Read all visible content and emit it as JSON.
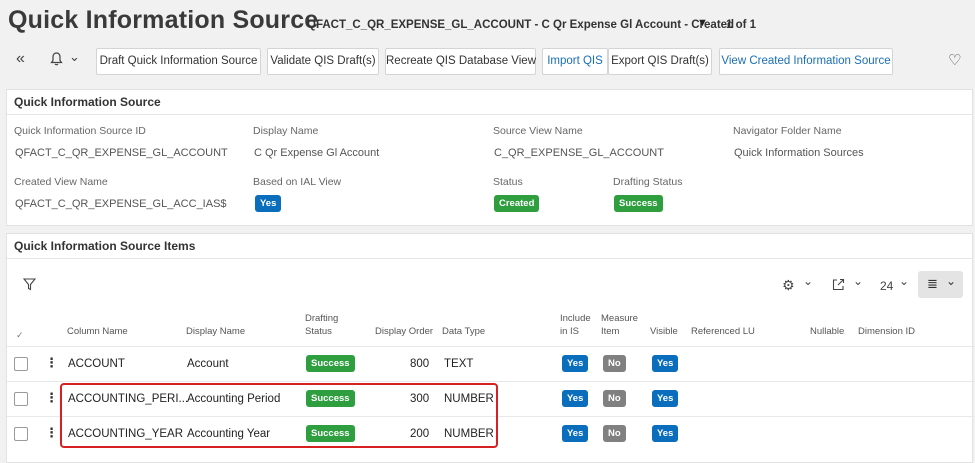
{
  "header": {
    "title": "Quick Information Source",
    "record": "QFACT_C_QR_EXPENSE_GL_ACCOUNT - C Qr Expense Gl Account - Created",
    "dropdown_glyph": "▼",
    "counter": "1 of 1"
  },
  "toolbar": {
    "collapse_icon": "«",
    "bell_icon": "🔔",
    "bell_chevron": "⌄",
    "buttons": [
      "Draft Quick Information Source",
      "Validate QIS Draft(s)",
      "Recreate QIS Database View",
      "Import QIS",
      "Export QIS Draft(s)",
      "View Created Information Source"
    ],
    "favorite_icon": "♡"
  },
  "details": {
    "heading": "Quick Information Source",
    "fields": {
      "qis_id": {
        "label": "Quick Information Source ID",
        "value": "QFACT_C_QR_EXPENSE_GL_ACCOUNT"
      },
      "display_name": {
        "label": "Display Name",
        "value": "C Qr Expense Gl Account"
      },
      "source_view": {
        "label": "Source View Name",
        "value": "C_QR_EXPENSE_GL_ACCOUNT"
      },
      "navigator_folder": {
        "label": "Navigator Folder Name",
        "value": "Quick Information Sources"
      },
      "created_view": {
        "label": "Created View Name",
        "value": "QFACT_C_QR_EXPENSE_GL_ACC_IAS$"
      },
      "based_on_ial": {
        "label": "Based on IAL View",
        "value": "Yes"
      },
      "status": {
        "label": "Status",
        "value": "Created"
      },
      "drafting_status": {
        "label": "Drafting Status",
        "value": "Success"
      }
    }
  },
  "items": {
    "heading": "Quick Information Source Items",
    "filter_icon": "⛉",
    "settings_icon": "⚙",
    "export_icon": "⇪",
    "chevron": "⌄",
    "page_size": "24",
    "view_icon": "≣",
    "select_all_glyph": "✓",
    "columns": {
      "column_name": "Column Name",
      "display_name": "Display Name",
      "drafting_status_1": "Drafting",
      "drafting_status_2": "Status",
      "display_order": "Display Order",
      "data_type": "Data Type",
      "include_1": "Include",
      "include_2": "in IS",
      "measure_1": "Measure",
      "measure_2": "Item",
      "visible": "Visible",
      "referenced_lu": "Referenced LU",
      "nullable": "Nullable",
      "dimension_id": "Dimension ID"
    },
    "rows": [
      {
        "column_name": "ACCOUNT",
        "display_name": "Account",
        "drafting_status": "Success",
        "display_order": "800",
        "data_type": "TEXT",
        "include_in_is": "Yes",
        "measure_item": "No",
        "visible": "Yes"
      },
      {
        "column_name": "ACCOUNTING_PERI...",
        "display_name": "Accounting Period",
        "drafting_status": "Success",
        "display_order": "300",
        "data_type": "NUMBER",
        "include_in_is": "Yes",
        "measure_item": "No",
        "visible": "Yes"
      },
      {
        "column_name": "ACCOUNTING_YEAR",
        "display_name": "Accounting Year",
        "drafting_status": "Success",
        "display_order": "200",
        "data_type": "NUMBER",
        "include_in_is": "Yes",
        "measure_item": "No",
        "visible": "Yes"
      }
    ],
    "kebab_glyph": "⋮"
  }
}
